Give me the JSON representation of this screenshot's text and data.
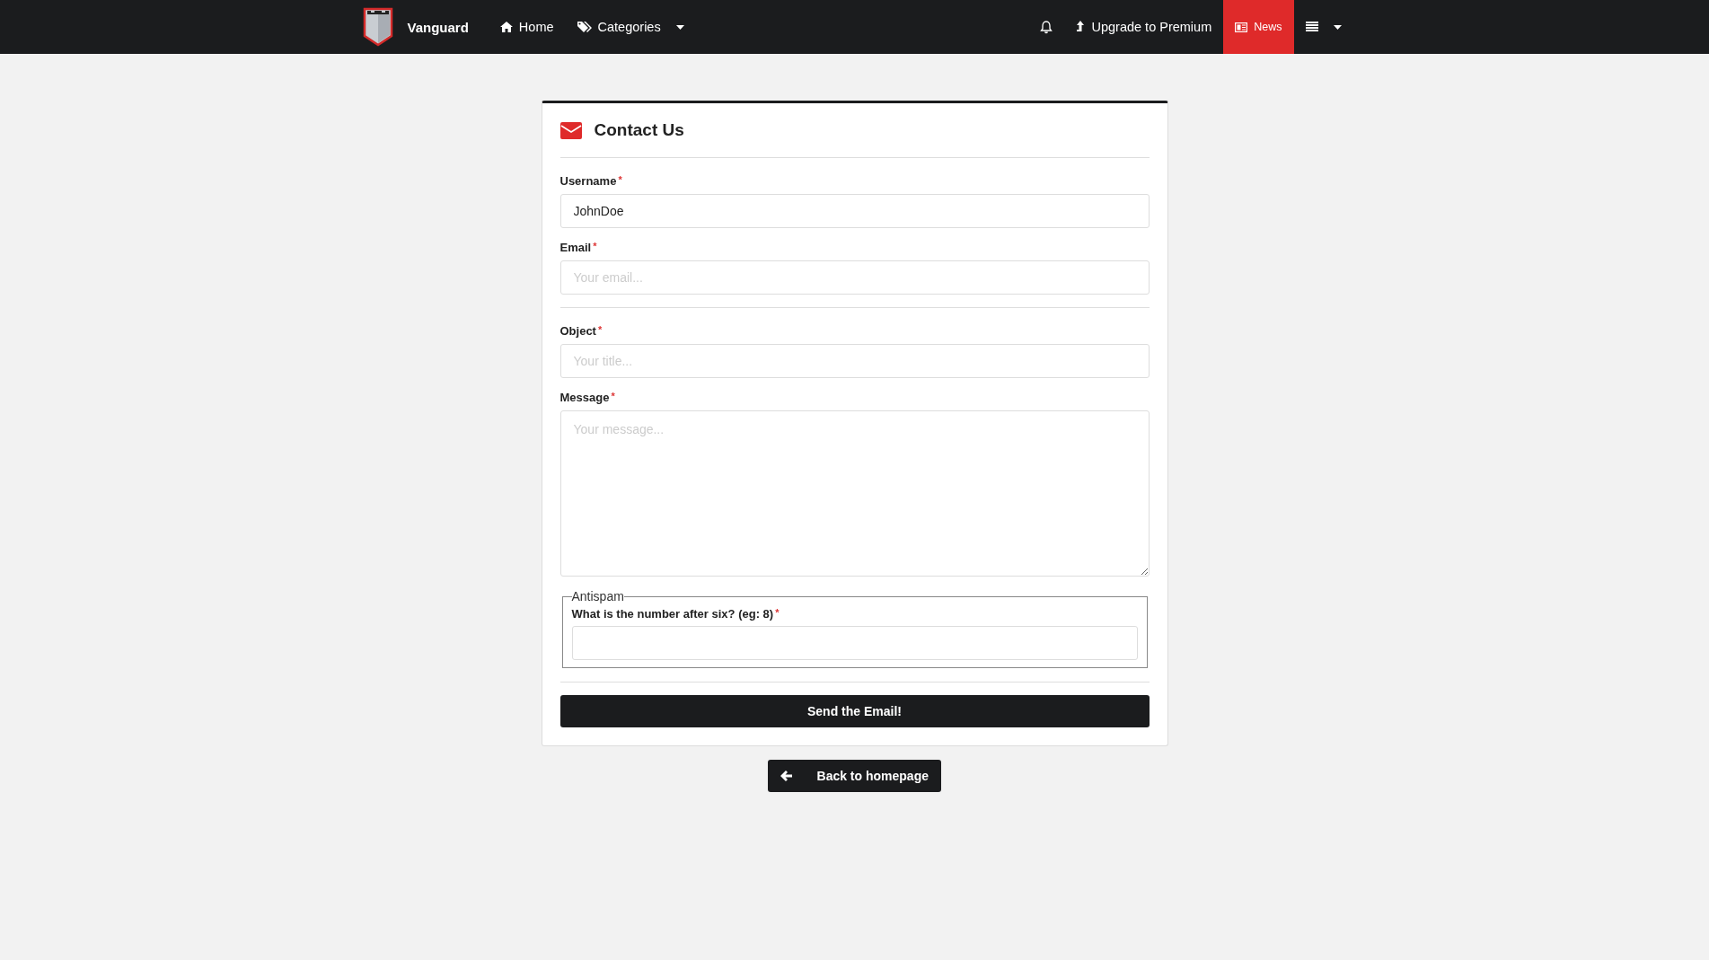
{
  "navbar": {
    "brand": "Vanguard",
    "left_items": [
      {
        "label": "Home",
        "selected": false,
        "dropdown": false
      },
      {
        "label": "Categories",
        "selected": false,
        "dropdown": true
      }
    ],
    "right_items": [
      {
        "selected": false,
        "dropdown": false
      },
      {
        "label": "Upgrade to Premium",
        "selected": false,
        "dropdown": false
      },
      {
        "label": "News",
        "selected": true,
        "dropdown": false
      },
      {
        "selected": false,
        "dropdown": true
      }
    ]
  },
  "card": {
    "title": "Contact Us",
    "field_groups": [
      [
        {
          "label": "Username",
          "required_mark": "*",
          "kind": "input",
          "value": "JohnDoe"
        },
        {
          "label": "Email",
          "required_mark": "*",
          "kind": "input",
          "placeholder": "Your email..."
        }
      ],
      [
        {
          "label": "Object",
          "required_mark": "*",
          "kind": "input",
          "placeholder": "Your title..."
        },
        {
          "label": "Message",
          "required_mark": "*",
          "kind": "textarea",
          "placeholder": "Your message..."
        }
      ]
    ],
    "antispam": {
      "legend": "Antispam",
      "label": "What is the number after six? (eg: 8)",
      "required_mark": "*"
    },
    "submit": "Send the Email!"
  },
  "back_button": "Back to homepage"
}
